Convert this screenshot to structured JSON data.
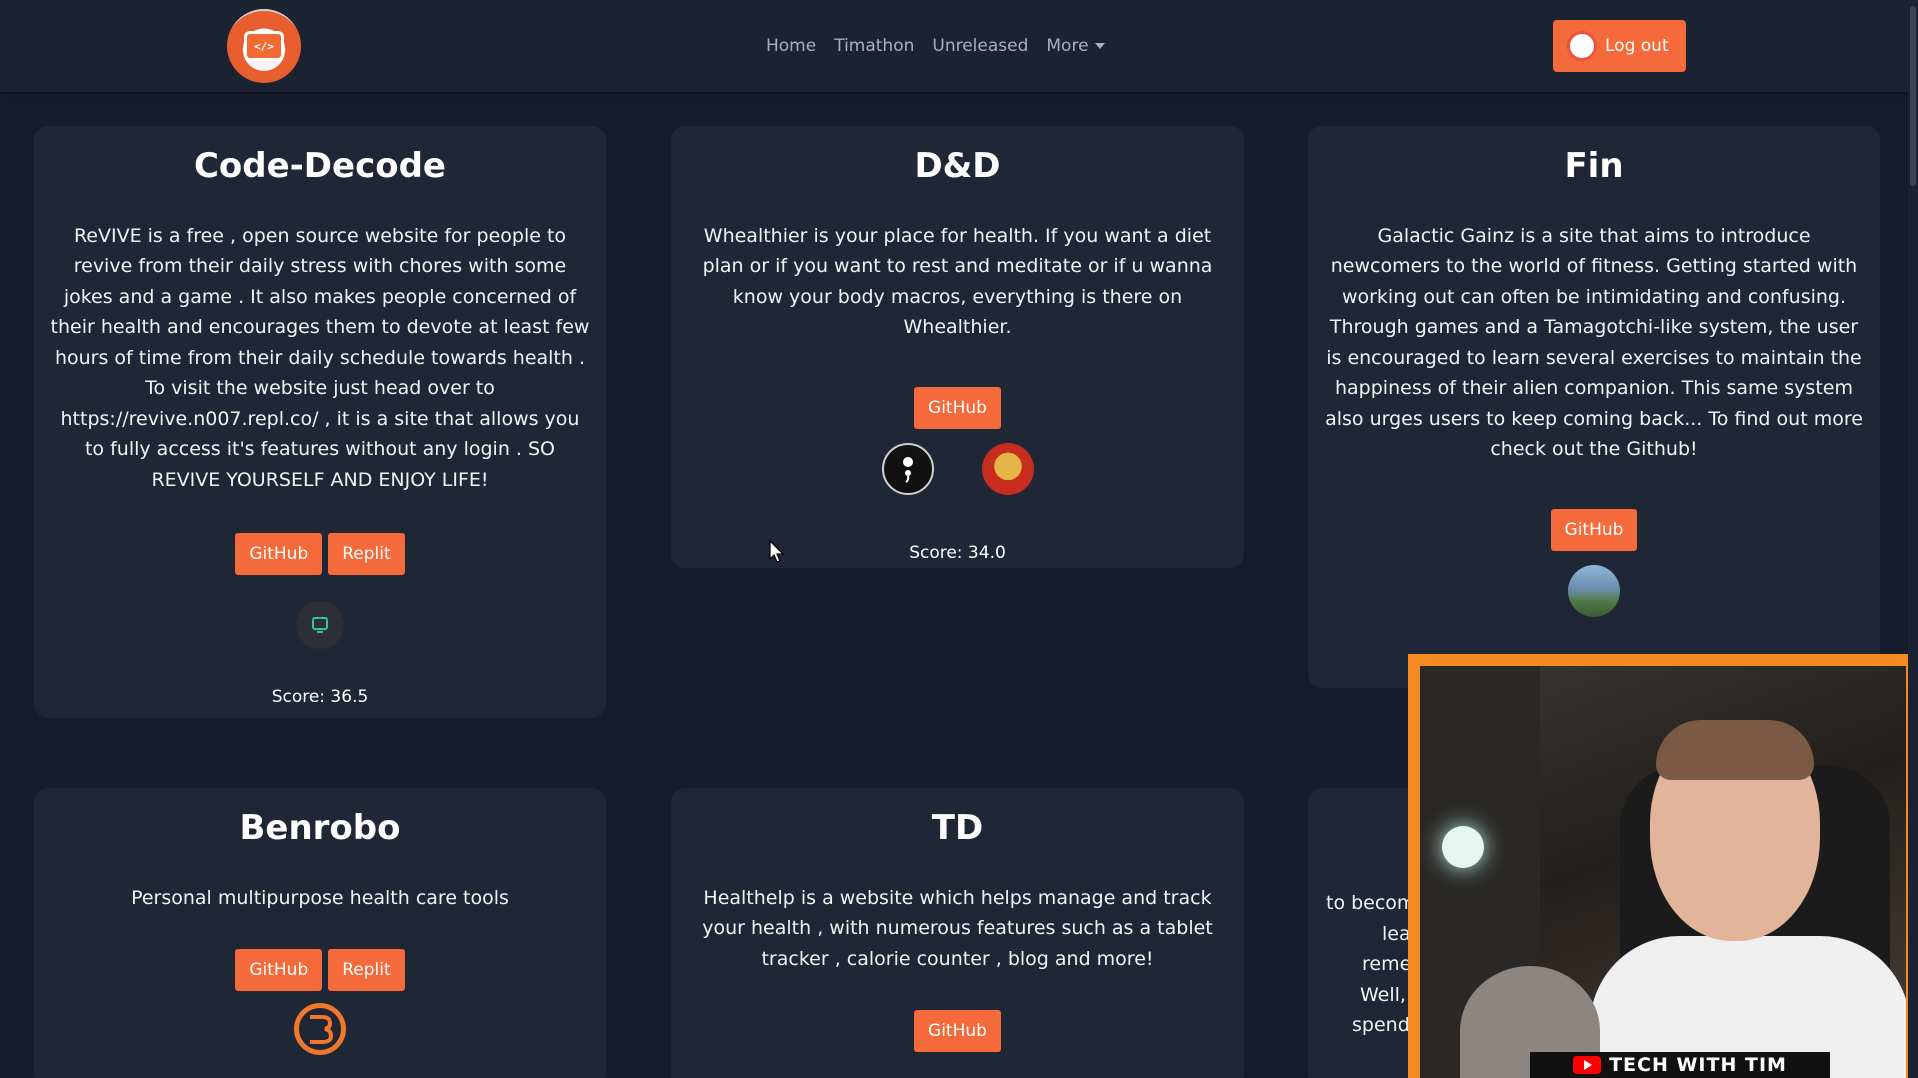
{
  "nav": {
    "links": [
      "Home",
      "Timathon",
      "Unreleased",
      "More"
    ],
    "logout_label": "Log out",
    "logo_glyph": "</>"
  },
  "cards": [
    {
      "title": "Code-Decode",
      "description": "ReVIVE is a free , open source website for people to revive from their daily stress with chores with some jokes and a game . It also makes people concerned of their health and encourages them to devote at least few hours of time from their daily schedule towards health . To visit the website just head over to https://revive.n007.repl.co/ , it is a site that allows you to fully access it's features without any login . SO REVIVE YOURSELF AND ENJOY LIFE!",
      "buttons": [
        "GitHub",
        "Replit"
      ],
      "score": "Score: 36.5"
    },
    {
      "title": "D&D",
      "description": "Whealthier is your place for health. If you want a diet plan or if you want to rest and meditate or if u wanna know your body macros, everything is there on Whealthier.",
      "buttons": [
        "GitHub"
      ],
      "score": "Score: 34.0"
    },
    {
      "title": "Fin",
      "description": "Galactic Gainz is a site that aims to introduce newcomers to the world of fitness. Getting started with working out can often be intimidating and confusing. Through games and a Tamagotchi-like system, the user is encouraged to learn several exercises to maintain the happiness of their alien companion. This same system also urges users to keep coming back... To find out more check out the Github!",
      "buttons": [
        "GitHub"
      ]
    },
    {
      "title": "Benrobo",
      "description": "Personal multipurpose health care tools",
      "buttons": [
        "GitHub",
        "Replit"
      ]
    },
    {
      "title": "TD",
      "description": "Healthelp is a website which helps manage and track your health , with numerous features such as a tablet tracker , calorie counter , blog and more!",
      "buttons": [
        "GitHub"
      ]
    }
  ],
  "partial_card_text": [
    "to becom",
    "learn",
    "rememb",
    "Well, gi",
    "spendin"
  ],
  "webcam": {
    "banner": "TECH WITH TIM"
  },
  "colors": {
    "background": "#161c2b",
    "card": "#1f2636",
    "accent": "#f56a3a",
    "webcam_border": "#f58a22"
  }
}
